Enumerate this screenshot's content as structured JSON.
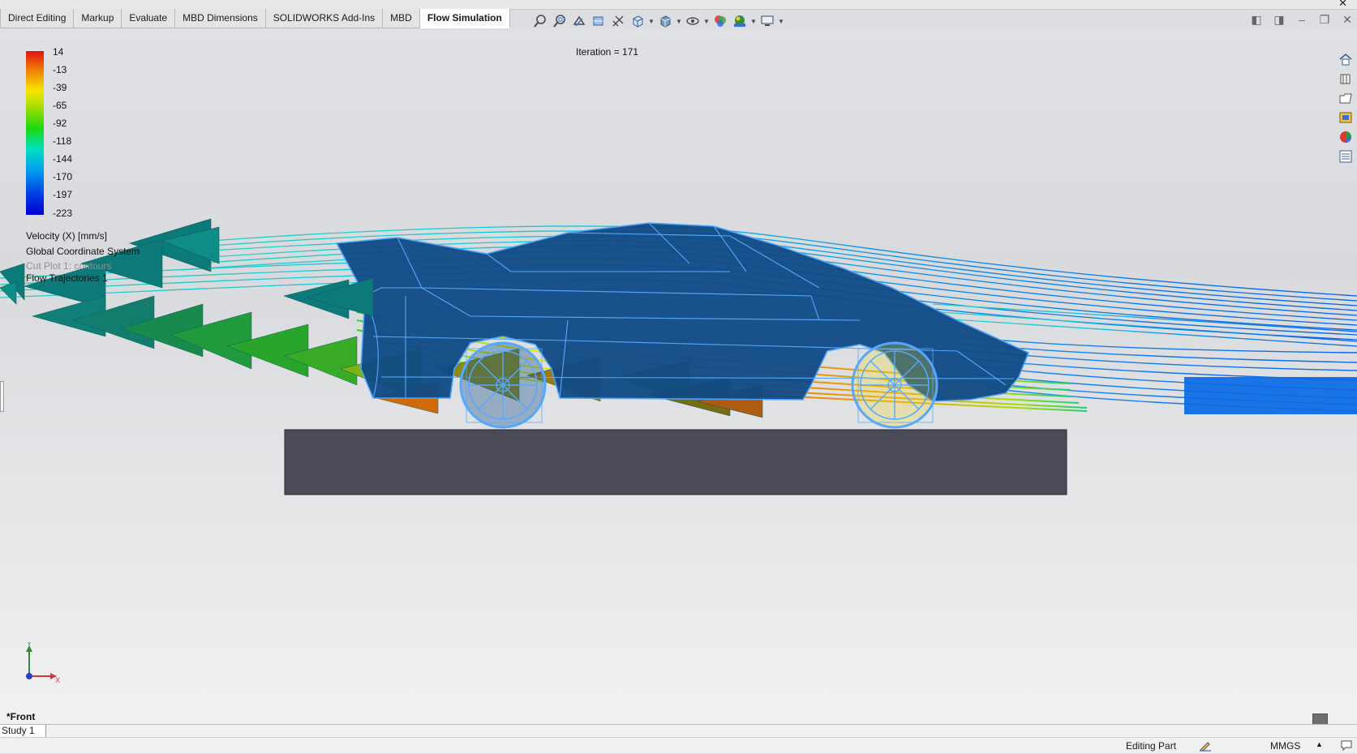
{
  "tabs": [
    {
      "label": "Direct Editing"
    },
    {
      "label": "Markup"
    },
    {
      "label": "Evaluate"
    },
    {
      "label": "MBD Dimensions"
    },
    {
      "label": "SOLIDWORKS Add-Ins"
    },
    {
      "label": "MBD"
    },
    {
      "label": "Flow Simulation",
      "active": true
    }
  ],
  "hud_icons": [
    "zoom-to-fit-icon",
    "zoom-to-area-icon",
    "previous-view-icon",
    "section-view-icon",
    "dynamic-annotation-icon",
    "view-orientation-icon",
    "display-style-icon",
    "hide-show-items-icon",
    "edit-appearance-icon",
    "apply-scene-icon",
    "view-settings-icon"
  ],
  "viewport": {
    "iteration": "Iteration = 171",
    "legend": {
      "ticks": [
        "14",
        "-13",
        "-39",
        "-65",
        "-92",
        "-118",
        "-144",
        "-170",
        "-197",
        "-223"
      ],
      "quantity": "Velocity (X) [mm/s]",
      "coord_system": "Global Coordinate System",
      "cut_plot": "Cut Plot 1: contours",
      "trajectories": "Flow Trajectories 1"
    },
    "triad": {
      "x": "X",
      "y": "Y"
    },
    "view_name": "*Front"
  },
  "study_tab": "Study 1",
  "status": {
    "mode": "Editing Part",
    "units": "MMGS",
    "caret": "▲"
  },
  "colors": {
    "active_tab_bg": "#ffffff",
    "block": "#4a4b57",
    "car_body": "#0f4a86",
    "car_outline": "#4aa3ff",
    "scale_max": "#e01010",
    "scale_min": "#0000d5"
  }
}
